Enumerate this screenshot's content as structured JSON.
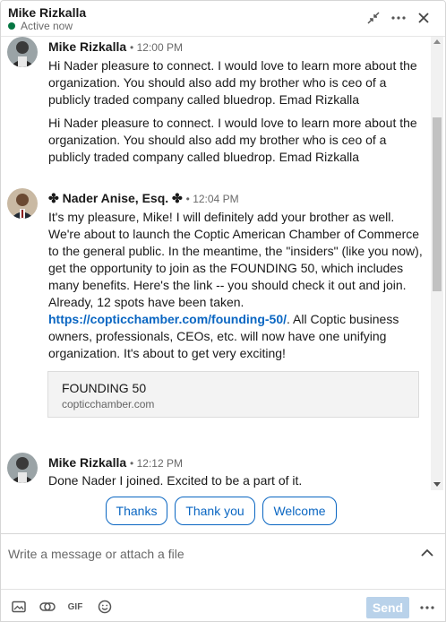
{
  "header": {
    "name": "Mike Rizkalla",
    "status": "Active now",
    "icons": [
      "minimize-icon",
      "more-icon",
      "close-icon"
    ],
    "colors": {
      "online": "#057642"
    }
  },
  "messages": [
    {
      "sender": "Mike Rizkalla",
      "time": "12:00 PM",
      "paragraphs": [
        "Hi Nader pleasure to connect. I would love to learn more about the organization. You should also add my brother who is ceo of a publicly traded company called bluedrop. Emad Rizkalla",
        "Hi Nader pleasure to connect. I would love to learn more about the organization. You should also add my brother who is ceo of a publicly traded company called bluedrop. Emad Rizkalla"
      ]
    },
    {
      "sender": "✤ Nader Anise, Esq. ✤",
      "time": "12:04 PM",
      "text_before_link": "It's my pleasure, Mike! I will definitely add your brother as well. We're about to launch the Coptic American Chamber of Commerce to the general public. In the meantime, the \"insiders\" (like you now), get the opportunity to join as the FOUNDING 50, which includes many benefits. Here's the link -- you should check it out and join. Already, 12 spots have been taken.",
      "link": "https://copticchamber.com/founding-50/",
      "text_after_link": ". All Coptic business owners, professionals, CEOs, etc. will now have one unifying organization. It's about to get very exciting!",
      "card": {
        "title": "FOUNDING 50",
        "domain": "copticchamber.com"
      }
    },
    {
      "sender": "Mike Rizkalla",
      "time": "12:12 PM",
      "text": "Done Nader I joined. Excited to be a part of it."
    }
  ],
  "quick_replies": [
    "Thanks",
    "Thank you",
    "Welcome"
  ],
  "compose": {
    "placeholder": "Write a message or attach a file",
    "send_label": "Send"
  },
  "footer": {
    "gif_label": "GIF",
    "icons": [
      "image-icon",
      "attach-icon",
      "gif-icon",
      "emoji-icon",
      "more-icon"
    ]
  },
  "colors": {
    "link": "#0a66c2",
    "send_disabled": "#b9d2ea"
  }
}
